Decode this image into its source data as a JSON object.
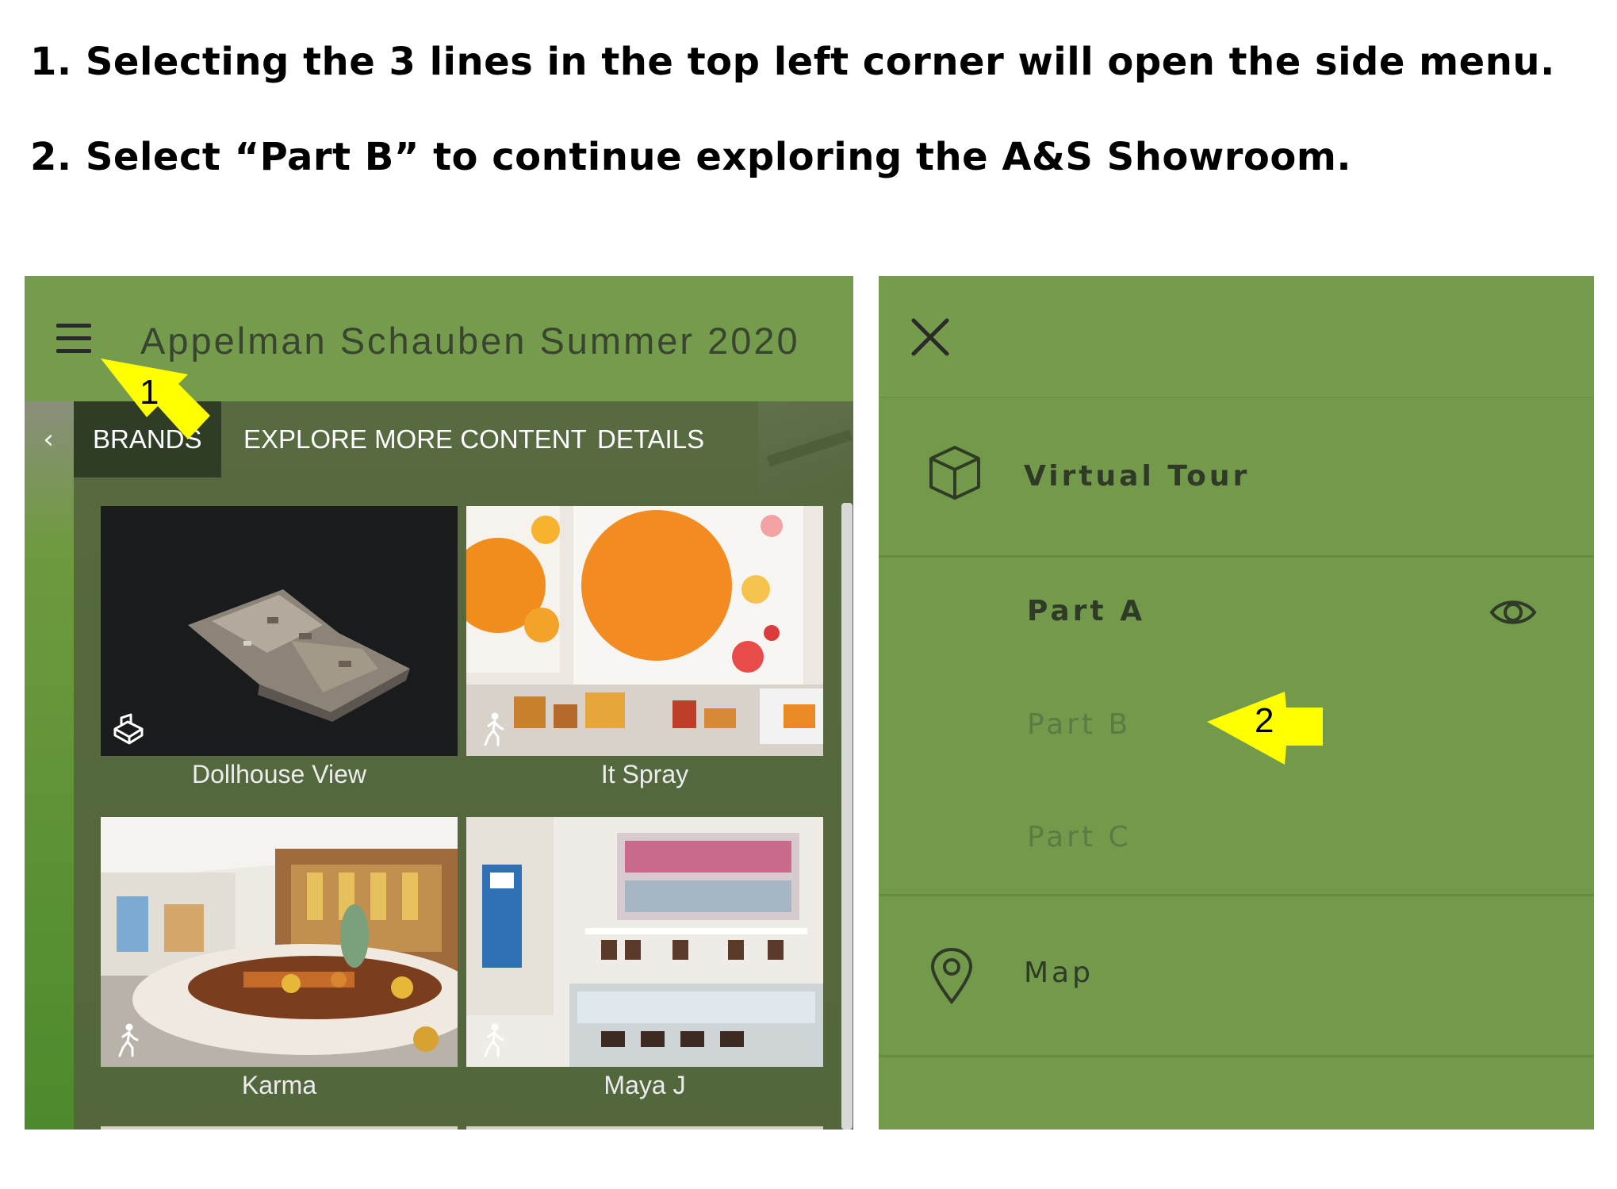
{
  "instructions": {
    "step1": "1. Selecting the 3 lines in the top left corner will open the side menu.",
    "step2": "2. Select “Part B” to continue exploring the A&S Showroom."
  },
  "left_screen": {
    "title": "Appelman Schauben Summer 2020",
    "tabs": [
      {
        "label": "BRANDS",
        "active": true
      },
      {
        "label": "EXPLORE MORE CONTENT",
        "active": false
      },
      {
        "label": "DETAILS",
        "active": false
      }
    ],
    "tiles": [
      {
        "label": "Dollhouse View",
        "icon": "dollhouse-icon"
      },
      {
        "label": "It Spray",
        "icon": "walk-icon"
      },
      {
        "label": "Karma",
        "icon": "walk-icon"
      },
      {
        "label": "Maya J",
        "icon": "walk-icon"
      }
    ],
    "callout_number": "1"
  },
  "right_screen": {
    "menu": {
      "virtual_tour": "Virtual Tour",
      "parts": [
        {
          "label": "Part A",
          "selected": true
        },
        {
          "label": "Part B",
          "selected": false
        },
        {
          "label": "Part C",
          "selected": false
        }
      ],
      "map": "Map"
    },
    "callout_number": "2"
  },
  "colors": {
    "header_green": "#749c4c",
    "callout_yellow": "#ffff00"
  }
}
